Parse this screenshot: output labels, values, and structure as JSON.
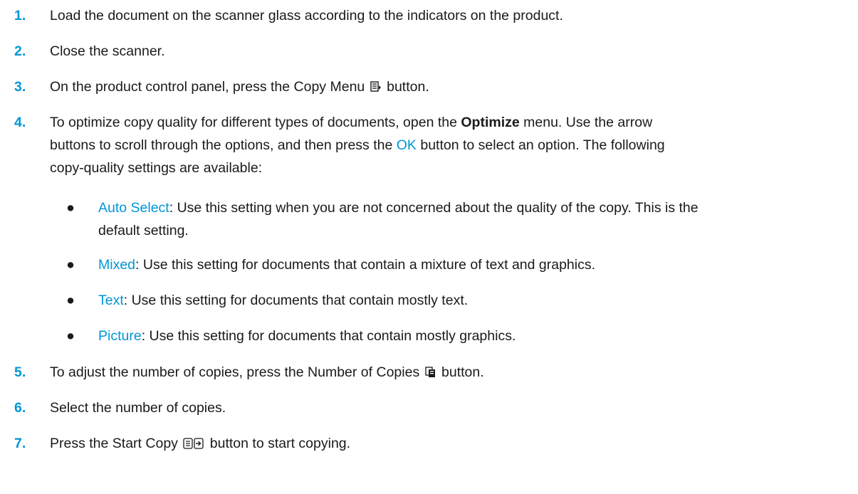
{
  "steps": [
    {
      "num": "1.",
      "text": "Load the document on the scanner glass according to the indicators on the product."
    },
    {
      "num": "2.",
      "text": "Close the scanner."
    },
    {
      "num": "3.",
      "text_before": "On the product control panel, press the Copy Menu",
      "text_after": "button.",
      "icon": "copy-menu-icon"
    },
    {
      "num": "4.",
      "line1_before": "To optimize copy quality for different types of documents, open the",
      "line1_bold": "Optimize",
      "line1_after": "menu. Use the arrow",
      "line2_before": "buttons to scroll through the options, and then press the",
      "line2_accent": "OK",
      "line2_after": "button to select an option. The following",
      "line3": "copy-quality settings are available:"
    },
    {
      "num": "5.",
      "text_before": "To adjust the number of copies, press the Number of Copies",
      "text_after": "button.",
      "icon": "number-of-copies-icon"
    },
    {
      "num": "6.",
      "text": "Select the number of copies."
    },
    {
      "num": "7.",
      "text_before": "Press the Start Copy",
      "text_after": "button to start copying.",
      "icon": "start-copy-icon"
    }
  ],
  "options": [
    {
      "name": "Auto Select",
      "line1": ": Use this setting when you are not concerned about the quality of the copy. This is the",
      "line2": "default setting."
    },
    {
      "name": "Mixed",
      "line1": ": Use this setting for documents that contain a mixture of text and graphics."
    },
    {
      "name": "Text",
      "line1": ": Use this setting for documents that contain mostly text."
    },
    {
      "name": "Picture",
      "line1": ": Use this setting for documents that contain mostly graphics."
    }
  ],
  "bullet_glyph": "●",
  "colors": {
    "accent": "#0096d6",
    "text": "#1a1a1a"
  }
}
